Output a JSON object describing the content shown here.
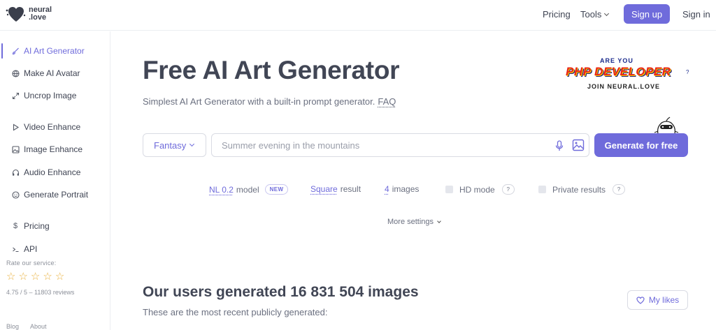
{
  "brand": {
    "name_line1": "neural",
    "name_line2": ".love"
  },
  "header": {
    "pricing": "Pricing",
    "tools": "Tools",
    "signup": "Sign up",
    "signin": "Sign in"
  },
  "sidebar": {
    "items": [
      {
        "label": "AI Art Generator",
        "icon": "brush-icon"
      },
      {
        "label": "Make AI Avatar",
        "icon": "globe-icon"
      },
      {
        "label": "Uncrop Image",
        "icon": "expand-icon"
      },
      {
        "label": "Video Enhance",
        "icon": "play-icon"
      },
      {
        "label": "Image Enhance",
        "icon": "image-icon"
      },
      {
        "label": "Audio Enhance",
        "icon": "headphones-icon"
      },
      {
        "label": "Generate Portrait",
        "icon": "smile-icon"
      },
      {
        "label": "Pricing",
        "icon": "dollar-icon"
      },
      {
        "label": "API",
        "icon": "terminal-icon"
      }
    ],
    "rate_label": "Rate our service:",
    "rating_value": "4.75 / 5 – 11803 reviews",
    "stars": 5,
    "footer": [
      "Blog",
      "About"
    ]
  },
  "main": {
    "title": "Free AI Art Generator",
    "subtitle": "Simplest AI Art Generator with a built-in prompt generator.",
    "faq": "FAQ",
    "ad": {
      "line1": "ARE YOU",
      "line2": "PHP DEVELOPER",
      "line3": "?",
      "line4": "JOIN NEURAL.LOVE"
    },
    "style_select": "Fantasy",
    "prompt_placeholder": "Summer evening in the mountains",
    "generate": "Generate for free",
    "options": {
      "model_link": "NL 0.2",
      "model_text": "model",
      "model_badge": "NEW",
      "result_link": "Square",
      "result_text": "result",
      "images_link": "4",
      "images_text": "images",
      "hd_mode": "HD mode",
      "private_results": "Private results",
      "help": "?"
    },
    "more_settings": "More settings",
    "generated_title": "Our users generated 16 831 504 images",
    "generated_sub": "These are the most recent publicly generated:",
    "my_likes": "My likes"
  },
  "colors": {
    "accent": "#6f6bdb",
    "text": "#414655",
    "muted": "#6b7080",
    "star": "#e9b03c"
  }
}
